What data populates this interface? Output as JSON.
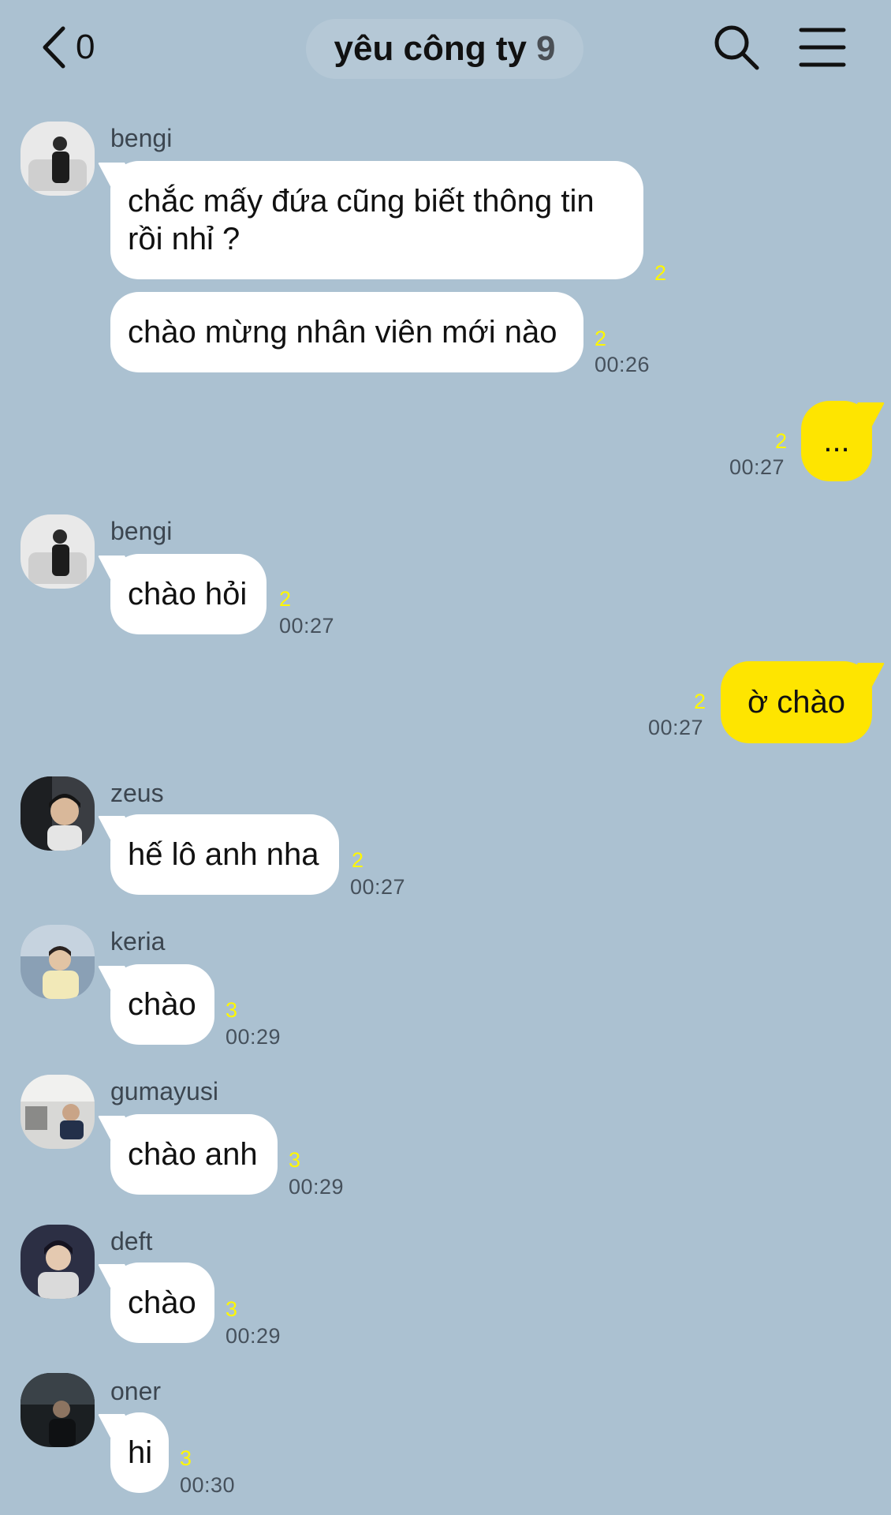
{
  "header": {
    "back_count": "0",
    "title": "yêu công ty",
    "member_count": "9"
  },
  "messages": [
    {
      "sender": "bengi",
      "lines": [
        "chắc mấy đứa cũng biết thông tin",
        "rồi nhỉ ?"
      ],
      "unread": "2",
      "time": ""
    },
    {
      "sender": "bengi",
      "text": "chào mừng nhân viên mới nào",
      "unread": "2",
      "time": "00:26"
    },
    {
      "sender": "me",
      "text": "...",
      "unread": "2",
      "time": "00:27"
    },
    {
      "sender": "bengi",
      "text": "chào hỏi",
      "unread": "2",
      "time": "00:27"
    },
    {
      "sender": "me",
      "text": "ờ chào",
      "unread": "2",
      "time": "00:27"
    },
    {
      "sender": "zeus",
      "text": "hế lô anh nha",
      "unread": "2",
      "time": "00:27"
    },
    {
      "sender": "keria",
      "text": "chào",
      "unread": "3",
      "time": "00:29"
    },
    {
      "sender": "gumayusi",
      "text": "chào anh",
      "unread": "3",
      "time": "00:29"
    },
    {
      "sender": "deft",
      "text": "chào",
      "unread": "3",
      "time": "00:29"
    },
    {
      "sender": "oner",
      "text": "hi",
      "unread": "3",
      "time": "00:30"
    }
  ],
  "colors": {
    "background": "#abc1d1",
    "my_bubble": "#fee500",
    "other_bubble": "#ffffff",
    "unread": "#fff700"
  }
}
